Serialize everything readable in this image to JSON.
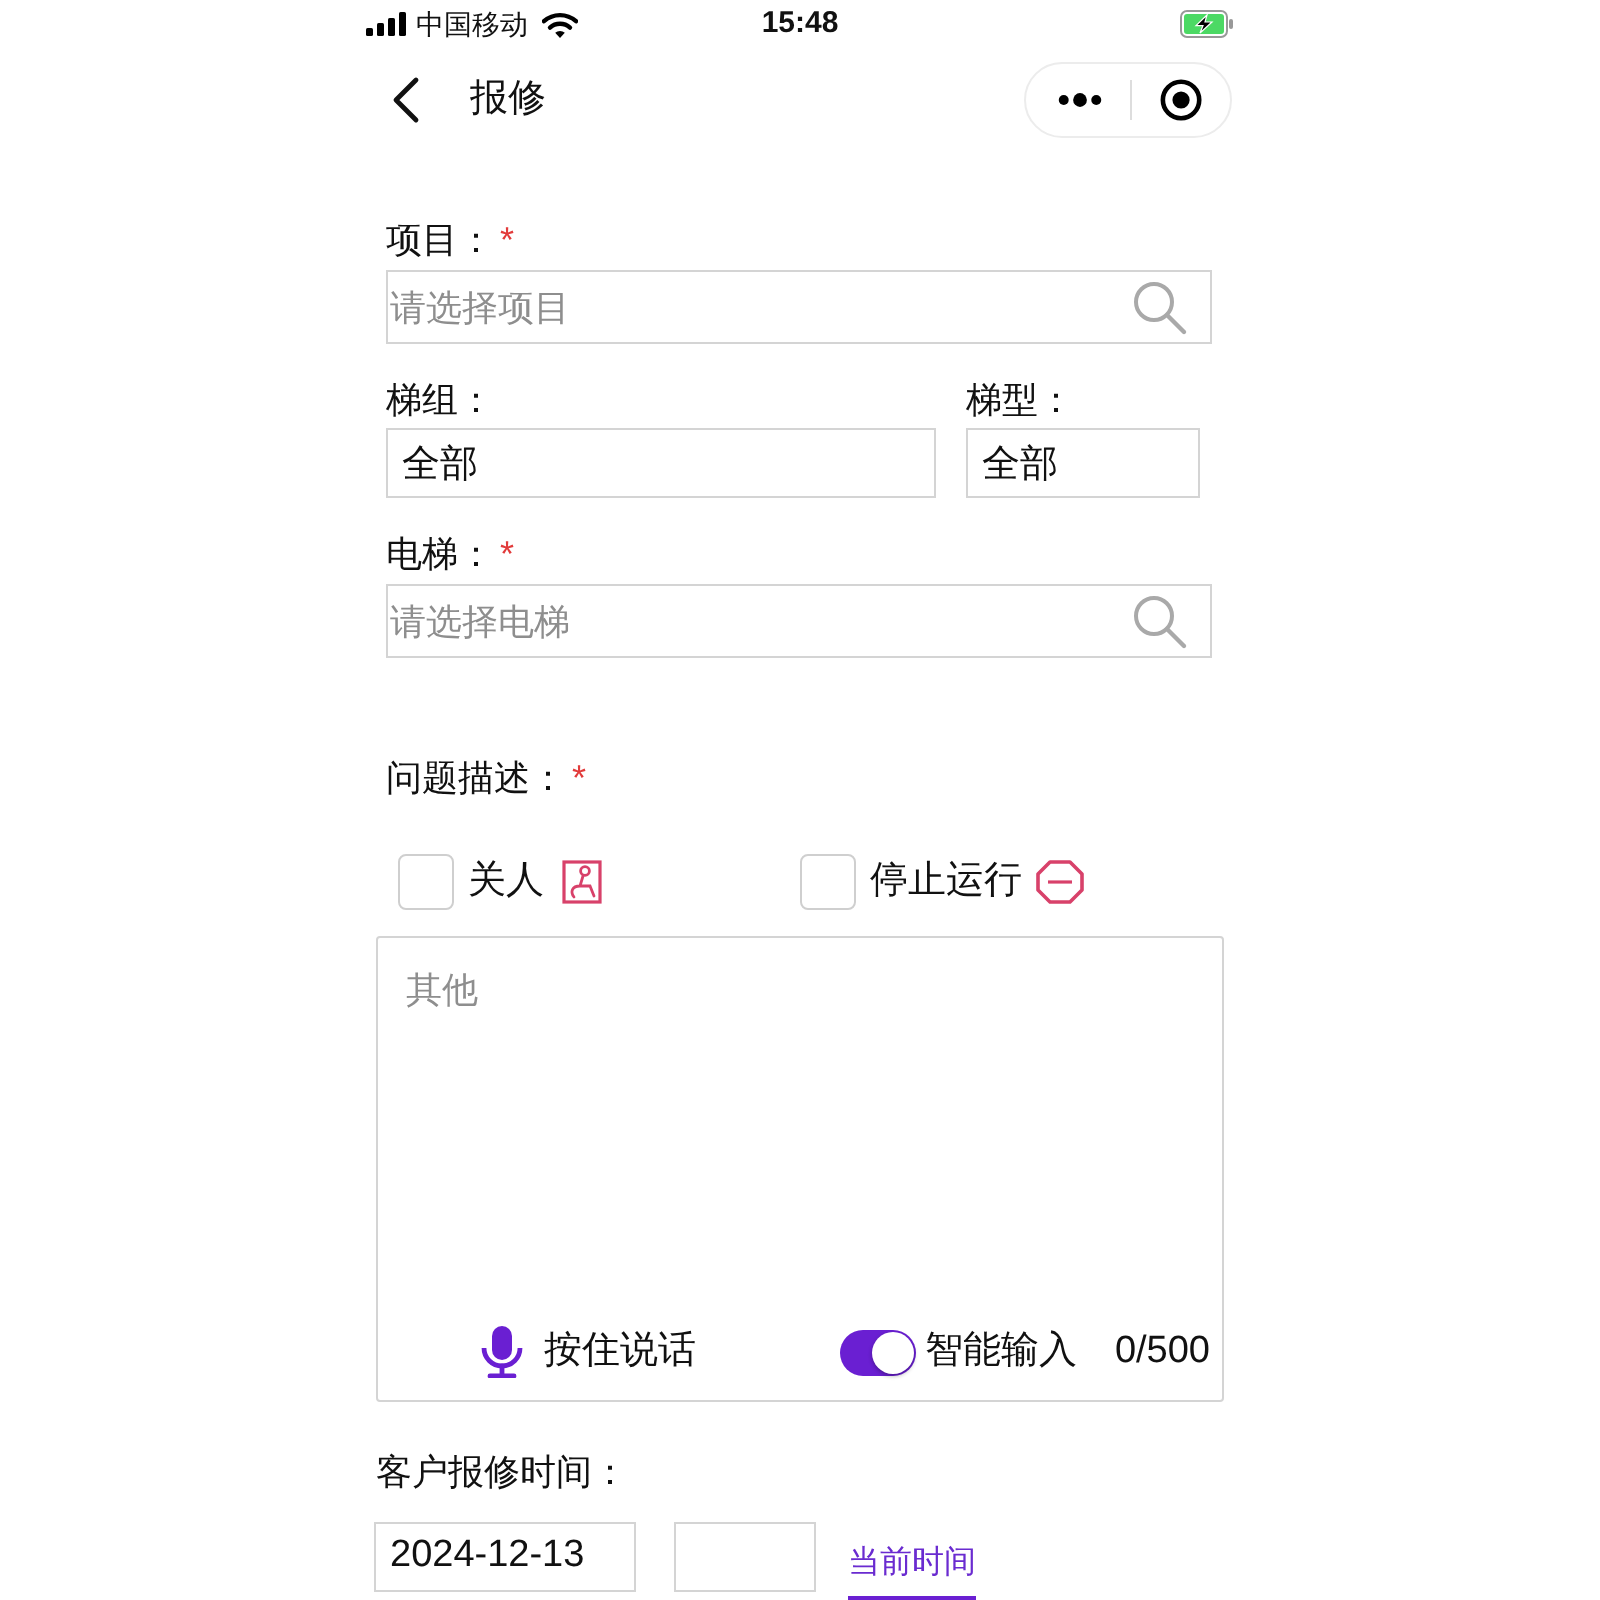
{
  "status_bar": {
    "carrier": "中国移动",
    "time": "15:48",
    "charging": true
  },
  "nav": {
    "title": "报修"
  },
  "fields": [
    {
      "kind": "search",
      "label": "项目：",
      "required_mark": "*",
      "placeholder": "请选择项目"
    },
    {
      "kind": "pair",
      "items": [
        {
          "label": "梯组：",
          "value": "全部"
        },
        {
          "label": "梯型：",
          "value": "全部"
        }
      ]
    },
    {
      "kind": "search",
      "label": "电梯：",
      "required_mark": "*",
      "placeholder": "请选择电梯"
    }
  ],
  "description": {
    "label": "问题描述：",
    "required_mark": "*",
    "options": [
      {
        "label": "关人",
        "checked": false
      },
      {
        "label": "停止运行",
        "checked": false
      }
    ],
    "placeholder": "其他",
    "voice_button": "按住说话",
    "smart_input": {
      "label": "智能输入",
      "on": true
    },
    "counter": "0/500"
  },
  "report_time": {
    "label": "客户报修时间：",
    "date": "2024-12-13",
    "link": "当前时间"
  }
}
